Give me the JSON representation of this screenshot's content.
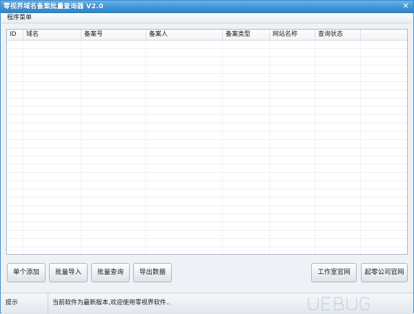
{
  "window": {
    "title": "零视界域名备案批量查询器 V2.0"
  },
  "menu": {
    "items": [
      {
        "label": "程序菜单"
      }
    ]
  },
  "table": {
    "columns": [
      "ID",
      "域名",
      "备案号",
      "备案人",
      "备案类型",
      "网站名称",
      "查询状态"
    ],
    "rows": []
  },
  "buttons": {
    "add_single": "单个添加",
    "batch_import": "批量导入",
    "batch_query": "批量查询",
    "export_data": "导出数据",
    "studio_site": "工作室官网",
    "company_site": "起零公司官网"
  },
  "status": {
    "label": "提示",
    "message": "当前软件为最新版本,欢迎使用零视界软件.."
  },
  "colors": {
    "titlebar": "#3f96d7",
    "window_bg": "#eef2f6",
    "border": "#a8b6c6"
  },
  "icons": {
    "close": "close-icon",
    "app": "app-icon"
  }
}
